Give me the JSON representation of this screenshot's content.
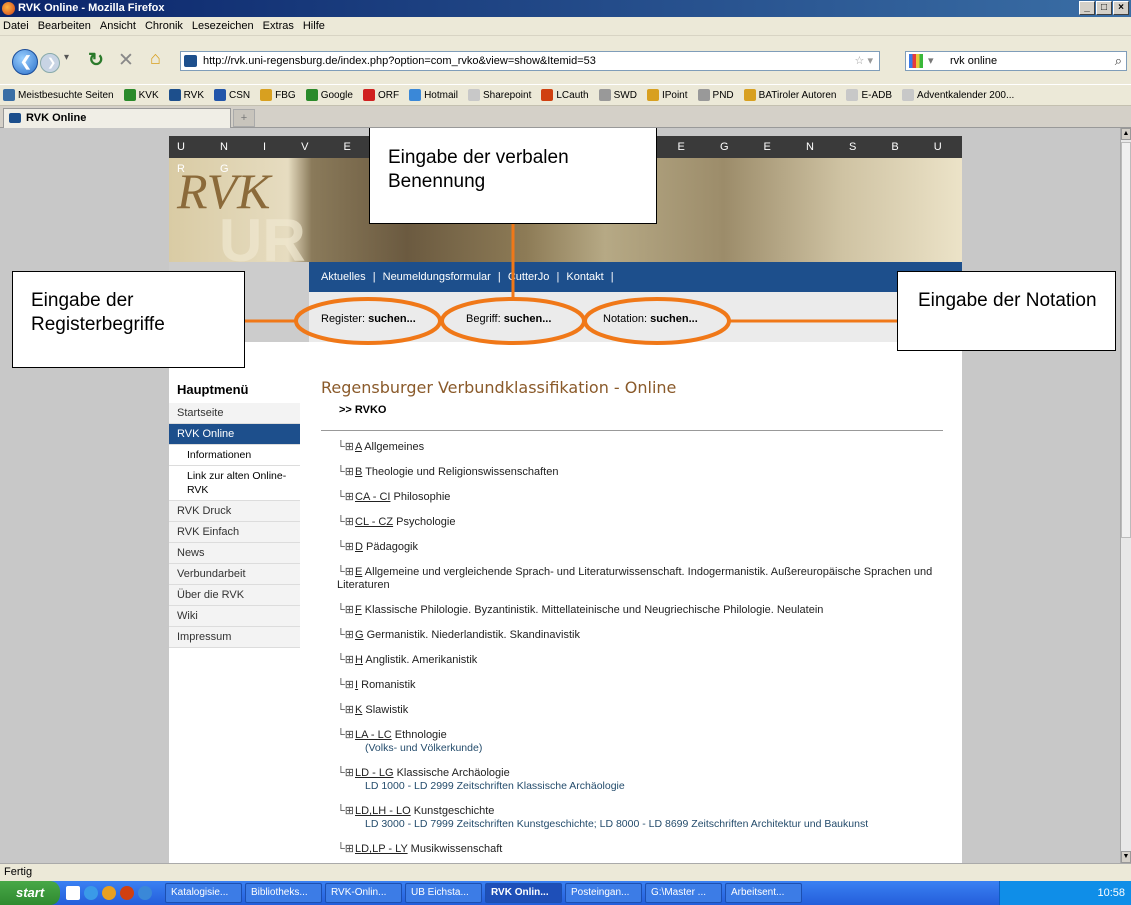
{
  "window": {
    "title": "RVK Online - Mozilla Firefox"
  },
  "menubar": [
    "Datei",
    "Bearbeiten",
    "Ansicht",
    "Chronik",
    "Lesezeichen",
    "Extras",
    "Hilfe"
  ],
  "navbar": {
    "url": "http://rvk.uni-regensburg.de/index.php?option=com_rvko&view=show&Itemid=53",
    "search_value": "rvk online"
  },
  "bookmarks": [
    {
      "label": "Meistbesuchte Seiten",
      "color": "#3a6ea5"
    },
    {
      "label": "KVK",
      "color": "#2a8a2a"
    },
    {
      "label": "RVK",
      "color": "#1d4f8c"
    },
    {
      "label": "CSN",
      "color": "#2255aa"
    },
    {
      "label": "FBG",
      "color": "#d8a020"
    },
    {
      "label": "Google",
      "color": "#2a8a2a"
    },
    {
      "label": "ORF",
      "color": "#d02020"
    },
    {
      "label": "Hotmail",
      "color": "#3a88d8"
    },
    {
      "label": "Sharepoint",
      "color": "#c8c8c8"
    },
    {
      "label": "LCauth",
      "color": "#d04010"
    },
    {
      "label": "SWD",
      "color": "#999999"
    },
    {
      "label": "IPoint",
      "color": "#d8a020"
    },
    {
      "label": "PND",
      "color": "#999999"
    },
    {
      "label": "BATiroler Autoren",
      "color": "#d8a020"
    },
    {
      "label": "E-ADB",
      "color": "#c8c8c8"
    },
    {
      "label": "Adventkalender 200...",
      "color": "#c8c8c8"
    }
  ],
  "tab": {
    "label": "RVK Online"
  },
  "banner": {
    "university": "U N I V E R S I T Ä T   R E G E N S B U R G",
    "logo": "RVK",
    "logo_sub": "UR"
  },
  "topnav": [
    "Aktuelles",
    "|",
    "Neumeldungsformular",
    "|",
    "CutterJo",
    "|",
    "Kontakt",
    "|"
  ],
  "search_fields": [
    {
      "label": "Register:",
      "action": "suchen..."
    },
    {
      "label": "Begriff:",
      "action": "suchen..."
    },
    {
      "label": "Notation:",
      "action": "suchen..."
    }
  ],
  "menu": {
    "heading": "Hauptmenü",
    "items": [
      "Startseite",
      "RVK Online",
      "Informationen",
      "Link zur alten Online-RVK",
      "RVK Druck",
      "RVK Einfach",
      "News",
      "Verbundarbeit",
      "Über die RVK",
      "Wiki",
      "Impressum"
    ]
  },
  "main": {
    "title": "Regensburger Verbundklassifikation - Online",
    "breadcrumb": ">> RVKO",
    "entries": [
      {
        "code": "A",
        "text": "Allgemeines",
        "sub": ""
      },
      {
        "code": "B",
        "text": "Theologie und Religionswissenschaften",
        "sub": ""
      },
      {
        "code": "CA - CI",
        "text": "Philosophie",
        "sub": ""
      },
      {
        "code": "CL - CZ",
        "text": "Psychologie",
        "sub": ""
      },
      {
        "code": "D",
        "text": "Pädagogik",
        "sub": ""
      },
      {
        "code": "E",
        "text": "Allgemeine und vergleichende Sprach- und Literaturwissenschaft. Indogermanistik. Außereuropäische Sprachen und Literaturen",
        "sub": ""
      },
      {
        "code": "F",
        "text": "Klassische Philologie. Byzantinistik. Mittellateinische und Neugriechische Philologie. Neulatein",
        "sub": ""
      },
      {
        "code": "G",
        "text": "Germanistik. Niederlandistik. Skandinavistik",
        "sub": ""
      },
      {
        "code": "H",
        "text": "Anglistik. Amerikanistik",
        "sub": ""
      },
      {
        "code": "I",
        "text": "Romanistik",
        "sub": ""
      },
      {
        "code": "K",
        "text": "Slawistik",
        "sub": ""
      },
      {
        "code": "LA - LC",
        "text": "Ethnologie",
        "sub": "(Volks- und Völkerkunde)"
      },
      {
        "code": "LD - LG",
        "text": "Klassische Archäologie",
        "sub": "LD 1000 - LD 2999 Zeitschriften Klassische Archäologie"
      },
      {
        "code": "LD,LH - LO",
        "text": "Kunstgeschichte",
        "sub": "LD 3000 - LD 7999 Zeitschriften Kunstgeschichte; LD 8000 - LD 8699 Zeitschriften Architektur und Baukunst"
      },
      {
        "code": "LD,LP - LY",
        "text": "Musikwissenschaft",
        "sub": ""
      }
    ]
  },
  "annotations": {
    "top": "Eingabe der verbalen Benennung",
    "left": "Eingabe der Registerbegriffe",
    "right": "Eingabe der Notation",
    "ellipse_color": "#f07818"
  },
  "status": "Fertig",
  "taskbar": {
    "start": "start",
    "items": [
      "Katalogisie...",
      "Bibliotheks...",
      "RVK-Onlin...",
      "UB Eichsta...",
      "RVK Onlin...",
      "Posteingan...",
      "G:\\Master ...",
      "Arbeitsent..."
    ],
    "active_index": 4,
    "clock": "10:58"
  }
}
